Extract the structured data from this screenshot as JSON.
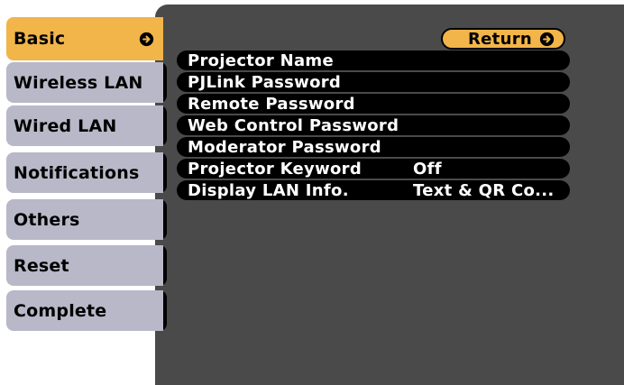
{
  "sidebar": {
    "items": [
      {
        "label": "Basic"
      },
      {
        "label": "Wireless LAN"
      },
      {
        "label": "Wired LAN"
      },
      {
        "label": "Notifications"
      },
      {
        "label": "Others"
      },
      {
        "label": "Reset"
      },
      {
        "label": "Complete"
      }
    ]
  },
  "header": {
    "return_label": "Return"
  },
  "menu": {
    "rows": [
      {
        "label": "Projector Name",
        "value": ""
      },
      {
        "label": "PJLink Password",
        "value": ""
      },
      {
        "label": "Remote Password",
        "value": ""
      },
      {
        "label": "Web Control Password",
        "value": ""
      },
      {
        "label": "Moderator Password",
        "value": ""
      },
      {
        "label": "Projector Keyword",
        "value": "Off"
      },
      {
        "label": "Display LAN Info.",
        "value": "Text & QR Co..."
      }
    ]
  },
  "colors": {
    "accent": "#f2b54a",
    "tab": "#b8b8c8",
    "panel": "#4a4a4a",
    "row": "#000000"
  },
  "icons": {
    "enter": "enter-arrow-icon"
  }
}
